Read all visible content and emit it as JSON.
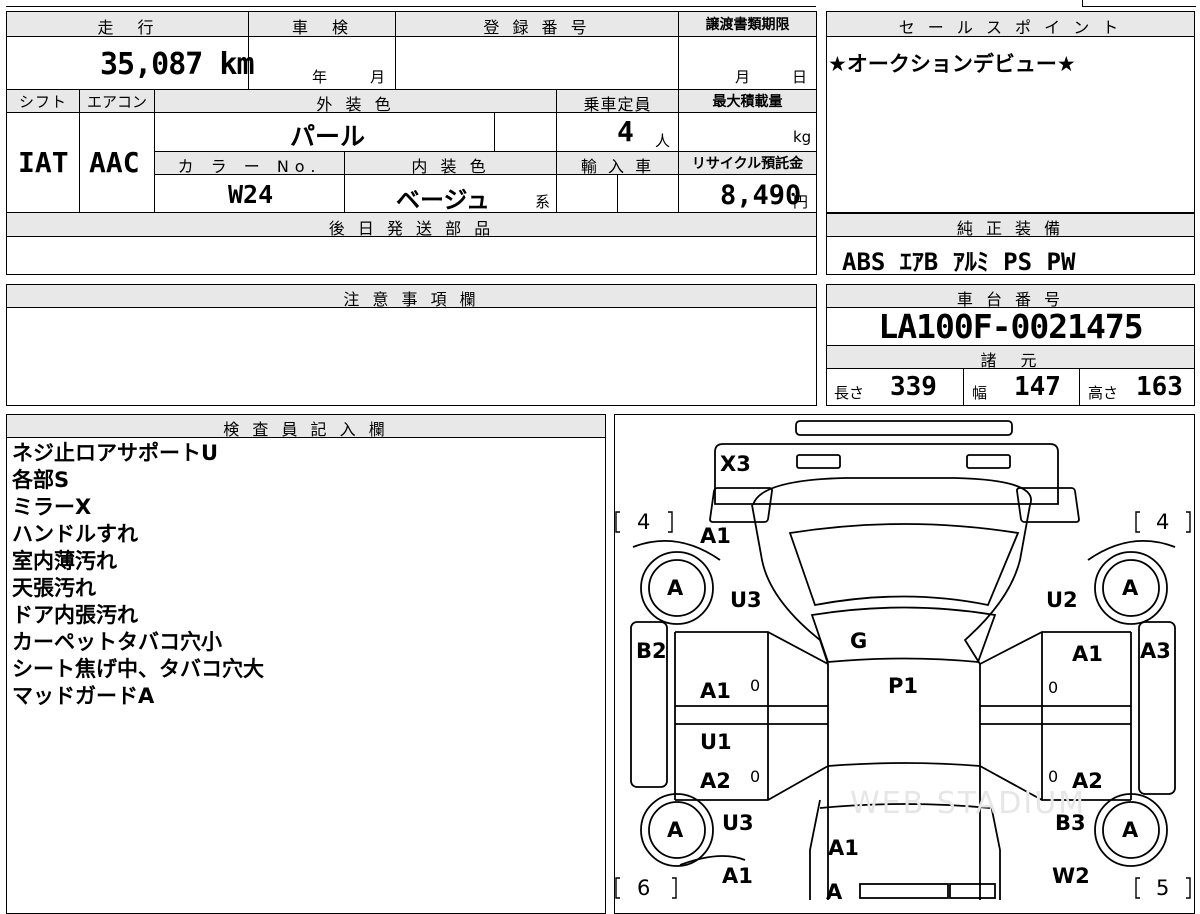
{
  "vehicle": {
    "mileage_label": "走　行",
    "mileage": "35,087 km",
    "inspection_label": "車　検",
    "inspection_year": "年",
    "inspection_month": "月",
    "registration_label": "登 録 番 号",
    "transfer_label": "譲渡書類期限",
    "transfer_month": "月",
    "transfer_day": "日",
    "shift_label": "シフト",
    "shift": "IAT",
    "ac_label": "エアコン",
    "ac": "AAC",
    "exterior_color_label": "外 装 色",
    "exterior_color": "パール",
    "capacity_label": "乗車定員",
    "capacity": "4",
    "capacity_unit": "人",
    "max_load_label": "最大積載量",
    "max_load_unit": "kg",
    "color_no_label": "カ ラ ー No.",
    "color_no": "W24",
    "interior_color_label": "内 装 色",
    "interior_color": "ベージュ",
    "interior_color_suffix": "系",
    "import_label": "輸 入 車",
    "recycle_label": "リサイクル預託金",
    "recycle_fee": "8,490",
    "recycle_unit": "円",
    "later_parts_label": "後 日 発 送 部 品"
  },
  "sales": {
    "label": "セ ー ル ス ポ イ ン ト",
    "text": "★オークションデビュー★"
  },
  "equipment": {
    "label": "純 正 装 備",
    "items": "ABS ｴｱB ｱﾙﾐ PS PW"
  },
  "notes": {
    "label": "注 意 事 項 欄"
  },
  "chassis": {
    "label": "車 台 番 号",
    "number": "LA100F-0021475"
  },
  "specs": {
    "label": "諸　元",
    "length_label": "長さ",
    "length": "339",
    "width_label": "幅",
    "width": "147",
    "height_label": "高さ",
    "height": "163"
  },
  "inspector": {
    "label": "検 査 員 記 入 欄",
    "lines": [
      "ネジ止ロアサポートU",
      "各部S",
      "ミラーX",
      "ハンドルすれ",
      "室内薄汚れ",
      "天張汚れ",
      "ドア内張汚れ",
      "カーペットタバコ穴小",
      "シート焦げ中、タバコ穴大",
      "マッドガードA"
    ]
  },
  "diagram": {
    "tread_fl": "4",
    "tread_fr": "4",
    "tread_rl": "6",
    "tread_rr": "5",
    "marks": {
      "x3": "X3",
      "fl_fender": "A1",
      "fr_wheel": "A",
      "fl_wheel": "A",
      "fl_u": "U3",
      "fr_u": "U2",
      "g": "G",
      "b2": "B2",
      "a3": "A3",
      "fr_door": "A1",
      "p1": "P1",
      "fl_door": "A1",
      "zero1": "0",
      "zero2": "0",
      "zero3": "0",
      "zero4": "0",
      "u1": "U1",
      "rl_door": "A2",
      "rr_door": "A2",
      "rl_u3": "U3",
      "rr_b3": "B3",
      "rl_wheel": "A",
      "rr_wheel": "A",
      "rear": "A1",
      "rl_bottom": "A1",
      "w2": "W2",
      "bottom_a": "A"
    },
    "watermark": "WEB STADIUM"
  }
}
